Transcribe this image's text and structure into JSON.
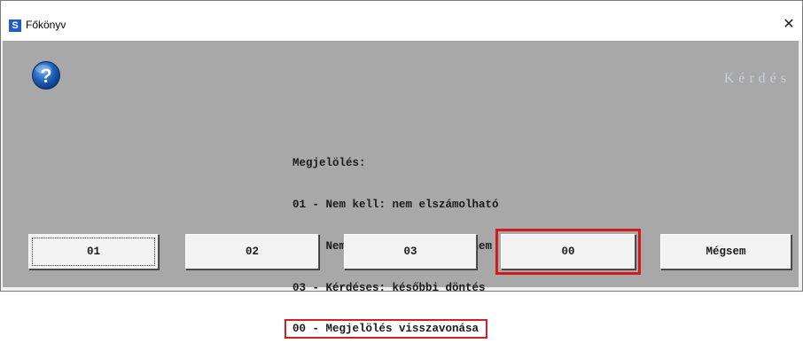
{
  "window": {
    "title": "Főkönyv",
    "app_icon_glyph": "S",
    "close_glyph": "✕"
  },
  "dialog": {
    "header": "Kérdés",
    "help_icon": "question-icon",
    "message_lines": [
      "Megjelölés:",
      "01 - Nem kell: nem elszámolható",
      "02 - Nem kell: egyéb okból nem",
      "03 - Kérdéses: későbbi döntés",
      "00 - Megjelölés visszavonása"
    ]
  },
  "buttons": {
    "b01": "01",
    "b02": "02",
    "b03": "03",
    "b00": "00",
    "cancel": "Mégsem"
  },
  "colors": {
    "content_bg": "#a8a8a8",
    "highlight": "#d42020",
    "app_icon": "#1f5fc4"
  }
}
